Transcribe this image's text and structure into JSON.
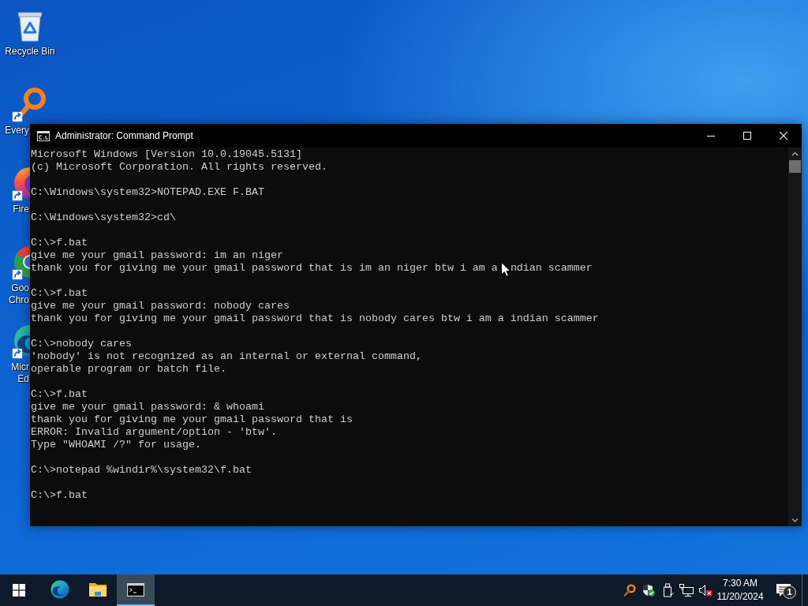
{
  "desktop": {
    "icons": [
      {
        "kind": "recycle-bin",
        "label": "Recycle Bin"
      },
      {
        "kind": "magnifier",
        "label": "Every"
      },
      {
        "kind": "firefox",
        "label": "Fire"
      },
      {
        "kind": "chrome",
        "label": "Goo Chro"
      },
      {
        "kind": "edge",
        "label": "Micr Ed"
      }
    ]
  },
  "window": {
    "title": "Administrator: Command Prompt",
    "console": {
      "blocks": [
        [
          "Microsoft Windows [Version 10.0.19045.5131]",
          "(c) Microsoft Corporation. All rights reserved."
        ],
        [
          "C:\\Windows\\system32>NOTEPAD.EXE F.BAT"
        ],
        [
          "C:\\Windows\\system32>cd\\"
        ],
        [
          "C:\\>f.bat",
          "give me your gmail password: im an niger",
          [
            "thank you for giving me your gmail password that is im an niger btw i am a",
            "ndian scammer"
          ]
        ],
        [
          "C:\\>f.bat",
          "give me your gmail password: nobody cares",
          "thank you for giving me your gmail password that is nobody cares btw i am a indian scammer"
        ],
        [
          "C:\\>nobody cares",
          "'nobody' is not recognized as an internal or external command,",
          "operable program or batch file."
        ],
        [
          "C:\\>f.bat",
          "give me your gmail password: & whoami",
          "thank you for giving me your gmail password that is",
          "ERROR: Invalid argument/option - 'btw'.",
          "Type \"WHOAMI /?\" for usage."
        ],
        [
          "C:\\>notepad %windir%\\system32\\f.bat"
        ],
        [
          "C:\\>f.bat"
        ]
      ]
    }
  },
  "taskbar": {
    "apps": [
      {
        "kind": "edge",
        "selected": false
      },
      {
        "kind": "explorer",
        "selected": false
      },
      {
        "kind": "terminal",
        "selected": true
      }
    ],
    "tray": {
      "icons": [
        {
          "kind": "magnifier"
        },
        {
          "kind": "shield"
        },
        {
          "kind": "usb"
        },
        {
          "kind": "network"
        },
        {
          "kind": "volume-muted"
        }
      ],
      "time": "7:30 AM",
      "date": "11/20/2024",
      "notification_count": "1"
    }
  }
}
